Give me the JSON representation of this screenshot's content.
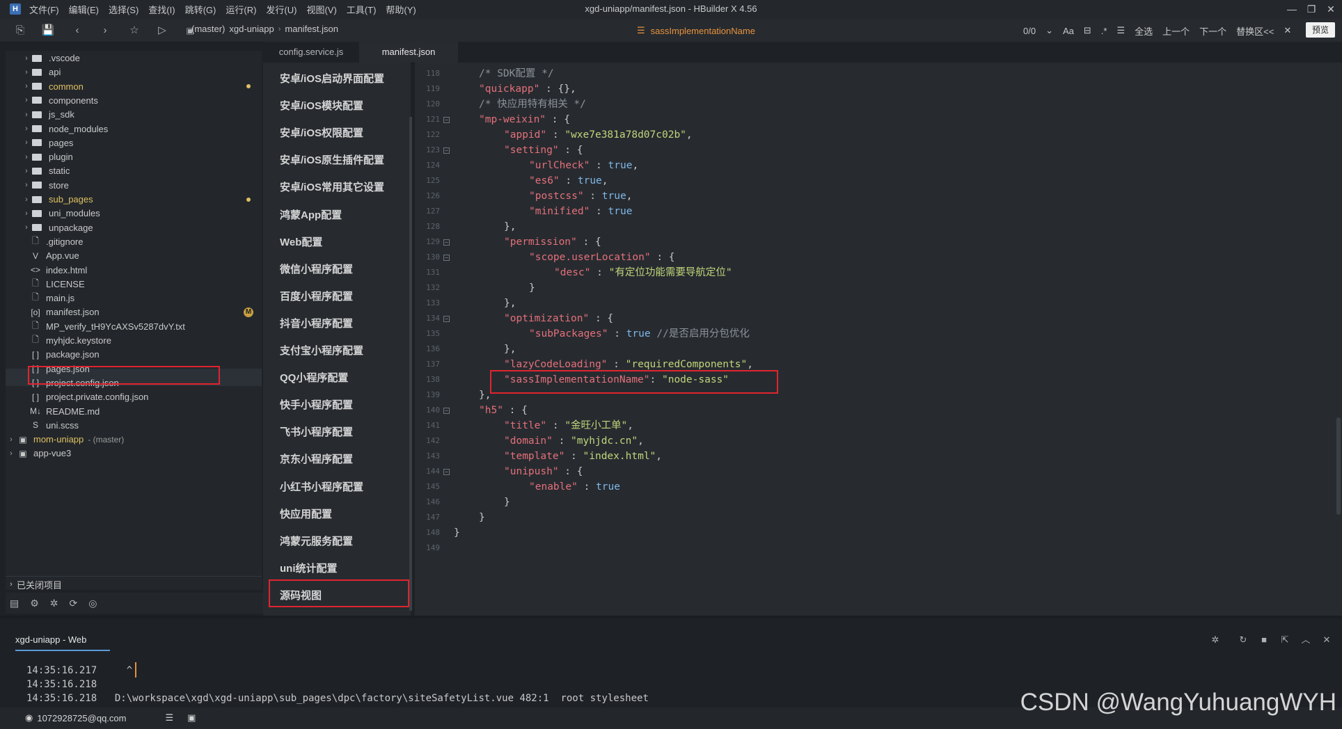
{
  "window": {
    "title": "xgd-uniapp/manifest.json - HBuilder X 4.56",
    "logo": "H",
    "minimize": "—",
    "restore": "❐",
    "close": "✕"
  },
  "menu": [
    "文件(F)",
    "编辑(E)",
    "选择(S)",
    "查找(I)",
    "跳转(G)",
    "运行(R)",
    "发行(U)",
    "视图(V)",
    "工具(T)",
    "帮助(Y)"
  ],
  "toolbar": {
    "breadcrumb": [
      "(master)",
      "xgd-uniapp",
      "manifest.json"
    ],
    "search_term": "sassImplementationName",
    "match_count": "0/0",
    "case_label": "Aa",
    "select_all": "全选",
    "prev": "上一个",
    "next": "下一个",
    "replace": "替换区<<",
    "close_find": "✕",
    "preview": "预览"
  },
  "sidebar": {
    "items": [
      {
        "label": ".vscode",
        "type": "folder"
      },
      {
        "label": "api",
        "type": "folder"
      },
      {
        "label": "common",
        "type": "folder",
        "modified": true
      },
      {
        "label": "components",
        "type": "folder"
      },
      {
        "label": "js_sdk",
        "type": "folder"
      },
      {
        "label": "node_modules",
        "type": "folder"
      },
      {
        "label": "pages",
        "type": "folder"
      },
      {
        "label": "plugin",
        "type": "folder"
      },
      {
        "label": "static",
        "type": "folder"
      },
      {
        "label": "store",
        "type": "folder"
      },
      {
        "label": "sub_pages",
        "type": "folder",
        "modified": true
      },
      {
        "label": "uni_modules",
        "type": "folder"
      },
      {
        "label": "unpackage",
        "type": "folder"
      },
      {
        "label": ".gitignore",
        "type": "file",
        "icon": "🗋"
      },
      {
        "label": "App.vue",
        "type": "file",
        "icon": "V"
      },
      {
        "label": "index.html",
        "type": "file",
        "icon": "<>"
      },
      {
        "label": "LICENSE",
        "type": "file",
        "icon": "🗋"
      },
      {
        "label": "main.js",
        "type": "file",
        "icon": "🗋"
      },
      {
        "label": "manifest.json",
        "type": "file",
        "icon": "[o]",
        "selected": true,
        "badge": "M"
      },
      {
        "label": "MP_verify_tH9YcAXSv5287dvY.txt",
        "type": "file",
        "icon": "🗋"
      },
      {
        "label": "myhjdc.keystore",
        "type": "file",
        "icon": "🗋"
      },
      {
        "label": "package.json",
        "type": "file",
        "icon": "[ ]"
      },
      {
        "label": "pages.json",
        "type": "file",
        "icon": "[ ]"
      },
      {
        "label": "project.config.json",
        "type": "file",
        "icon": "[ ]"
      },
      {
        "label": "project.private.config.json",
        "type": "file",
        "icon": "[ ]"
      },
      {
        "label": "README.md",
        "type": "file",
        "icon": "M↓"
      },
      {
        "label": "uni.scss",
        "type": "file",
        "icon": "S"
      }
    ],
    "projects": [
      {
        "label": "mom-uniapp",
        "branch": "- (master)"
      },
      {
        "label": "app-vue3",
        "branch": ""
      }
    ],
    "closed_projects": "已关闭项目"
  },
  "tabs": [
    {
      "label": "config.service.js"
    },
    {
      "label": "manifest.json"
    }
  ],
  "config_menu": [
    "安卓/iOS启动界面配置",
    "安卓/iOS模块配置",
    "安卓/iOS权限配置",
    "安卓/iOS原生插件配置",
    "安卓/iOS常用其它设置",
    "鸿蒙App配置",
    "Web配置",
    "微信小程序配置",
    "百度小程序配置",
    "抖音小程序配置",
    "支付宝小程序配置",
    "QQ小程序配置",
    "快手小程序配置",
    "飞书小程序配置",
    "京东小程序配置",
    "小红书小程序配置",
    "快应用配置",
    "鸿蒙元服务配置",
    "uni统计配置",
    "源码视图"
  ],
  "code": [
    {
      "n": "118",
      "indent": 1,
      "parts": [
        [
          "c",
          "/* SDK配置 */"
        ]
      ]
    },
    {
      "n": "119",
      "indent": 1,
      "parts": [
        [
          "k",
          "\"quickapp\""
        ],
        [
          "p",
          " : {},"
        ]
      ]
    },
    {
      "n": "120",
      "indent": 1,
      "parts": [
        [
          "c",
          "/* 快应用特有相关 */"
        ]
      ]
    },
    {
      "n": "121",
      "indent": 1,
      "fold": true,
      "parts": [
        [
          "k",
          "\"mp-weixin\""
        ],
        [
          "p",
          " : {"
        ]
      ]
    },
    {
      "n": "122",
      "indent": 2,
      "parts": [
        [
          "k",
          "\"appid\""
        ],
        [
          "p",
          " : "
        ],
        [
          "s",
          "\"wxe7e381a78d07c02b\""
        ],
        [
          "p",
          ","
        ]
      ]
    },
    {
      "n": "123",
      "indent": 2,
      "fold": true,
      "parts": [
        [
          "k",
          "\"setting\""
        ],
        [
          "p",
          " : {"
        ]
      ]
    },
    {
      "n": "124",
      "indent": 3,
      "parts": [
        [
          "k",
          "\"urlCheck\""
        ],
        [
          "p",
          " : "
        ],
        [
          "b",
          "true"
        ],
        [
          "p",
          ","
        ]
      ]
    },
    {
      "n": "125",
      "indent": 3,
      "parts": [
        [
          "k",
          "\"es6\""
        ],
        [
          "p",
          " : "
        ],
        [
          "b",
          "true"
        ],
        [
          "p",
          ","
        ]
      ]
    },
    {
      "n": "126",
      "indent": 3,
      "parts": [
        [
          "k",
          "\"postcss\""
        ],
        [
          "p",
          " : "
        ],
        [
          "b",
          "true"
        ],
        [
          "p",
          ","
        ]
      ]
    },
    {
      "n": "127",
      "indent": 3,
      "parts": [
        [
          "k",
          "\"minified\""
        ],
        [
          "p",
          " : "
        ],
        [
          "b",
          "true"
        ]
      ]
    },
    {
      "n": "128",
      "indent": 2,
      "parts": [
        [
          "p",
          "},"
        ]
      ]
    },
    {
      "n": "129",
      "indent": 2,
      "fold": true,
      "parts": [
        [
          "k",
          "\"permission\""
        ],
        [
          "p",
          " : {"
        ]
      ]
    },
    {
      "n": "130",
      "indent": 3,
      "fold": true,
      "parts": [
        [
          "k",
          "\"scope.userLocation\""
        ],
        [
          "p",
          " : {"
        ]
      ]
    },
    {
      "n": "131",
      "indent": 4,
      "parts": [
        [
          "k",
          "\"desc\""
        ],
        [
          "p",
          " : "
        ],
        [
          "s",
          "\"有定位功能需要导航定位\""
        ]
      ]
    },
    {
      "n": "132",
      "indent": 3,
      "parts": [
        [
          "p",
          "}"
        ]
      ]
    },
    {
      "n": "133",
      "indent": 2,
      "parts": [
        [
          "p",
          "},"
        ]
      ]
    },
    {
      "n": "134",
      "indent": 2,
      "fold": true,
      "parts": [
        [
          "k",
          "\"optimization\""
        ],
        [
          "p",
          " : {"
        ]
      ]
    },
    {
      "n": "135",
      "indent": 3,
      "parts": [
        [
          "k",
          "\"subPackages\""
        ],
        [
          "p",
          " : "
        ],
        [
          "b",
          "true"
        ],
        [
          "c",
          " //是否启用分包优化"
        ]
      ]
    },
    {
      "n": "136",
      "indent": 2,
      "parts": [
        [
          "p",
          "},"
        ]
      ]
    },
    {
      "n": "137",
      "indent": 2,
      "parts": [
        [
          "k",
          "\"lazyCodeLoading\""
        ],
        [
          "p",
          " : "
        ],
        [
          "s",
          "\"requiredComponents\""
        ],
        [
          "p",
          ","
        ]
      ]
    },
    {
      "n": "138",
      "indent": 2,
      "parts": [
        [
          "k",
          "\"sassImplementationName\""
        ],
        [
          "p",
          ": "
        ],
        [
          "s",
          "\"node-sass\""
        ]
      ]
    },
    {
      "n": "139",
      "indent": 1,
      "parts": [
        [
          "p",
          "},"
        ]
      ]
    },
    {
      "n": "140",
      "indent": 1,
      "fold": true,
      "parts": [
        [
          "k",
          "\"h5\""
        ],
        [
          "p",
          " : {"
        ]
      ]
    },
    {
      "n": "141",
      "indent": 2,
      "parts": [
        [
          "k",
          "\"title\""
        ],
        [
          "p",
          " : "
        ],
        [
          "s",
          "\"金旺小工单\""
        ],
        [
          "p",
          ","
        ]
      ]
    },
    {
      "n": "142",
      "indent": 2,
      "parts": [
        [
          "k",
          "\"domain\""
        ],
        [
          "p",
          " : "
        ],
        [
          "s",
          "\"myhjdc.cn\""
        ],
        [
          "p",
          ","
        ]
      ]
    },
    {
      "n": "143",
      "indent": 2,
      "parts": [
        [
          "k",
          "\"template\""
        ],
        [
          "p",
          " : "
        ],
        [
          "s",
          "\"index.html\""
        ],
        [
          "p",
          ","
        ]
      ]
    },
    {
      "n": "144",
      "indent": 2,
      "fold": true,
      "parts": [
        [
          "k",
          "\"unipush\""
        ],
        [
          "p",
          " : {"
        ]
      ]
    },
    {
      "n": "145",
      "indent": 3,
      "parts": [
        [
          "k",
          "\"enable\""
        ],
        [
          "p",
          " : "
        ],
        [
          "b",
          "true"
        ]
      ]
    },
    {
      "n": "146",
      "indent": 2,
      "parts": [
        [
          "p",
          "}"
        ]
      ]
    },
    {
      "n": "147",
      "indent": 1,
      "parts": [
        [
          "p",
          "}"
        ]
      ]
    },
    {
      "n": "148",
      "indent": 0,
      "parts": [
        [
          "p",
          "}"
        ]
      ]
    },
    {
      "n": "149",
      "indent": 0,
      "parts": []
    }
  ],
  "console": {
    "tab": "xgd-uniapp - Web",
    "lines": [
      {
        "time": "14:35:16.217",
        "text": "    ^"
      },
      {
        "time": "14:35:16.218",
        "text": ""
      },
      {
        "time": "14:35:16.218",
        "text": "  D:\\workspace\\xgd\\xgd-uniapp\\sub_pages\\dpc\\factory\\siteSafetyList.vue 482:1  root stylesheet"
      }
    ]
  },
  "status": {
    "user": "1072928725@qq.com"
  },
  "watermark": "CSDN @WangYuhuangWYH"
}
